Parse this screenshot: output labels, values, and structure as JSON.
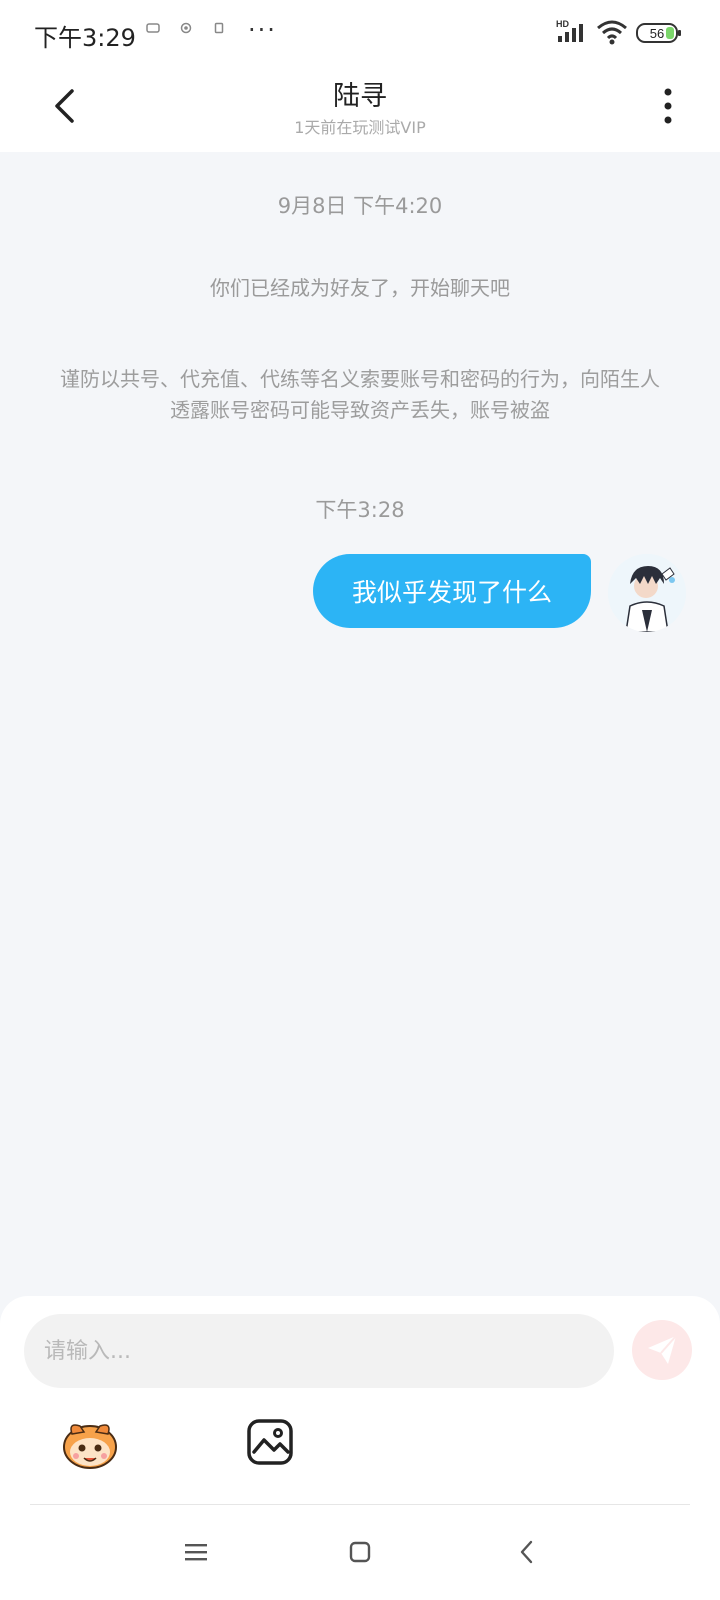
{
  "status_bar": {
    "time": "下午3:29",
    "dots": "···",
    "hd_label": "HD",
    "battery": "56"
  },
  "header": {
    "title": "陆寻",
    "subtitle": "1天前在玩测试VIP"
  },
  "chat": {
    "timestamp_1": "9月8日 下午4:20",
    "system_friend": "你们已经成为好友了，开始聊天吧",
    "system_warning": "谨防以共号、代充值、代练等名义索要账号和密码的行为，向陌生人透露账号密码可能导致资产丢失，账号被盗",
    "timestamp_2": "下午3:28",
    "message_1": "我似乎发现了什么"
  },
  "composer": {
    "placeholder": "请输入..."
  },
  "colors": {
    "bubble": "#2cb4f5",
    "background": "#f4f6f9",
    "send_button_bg": "#fde8e8"
  }
}
